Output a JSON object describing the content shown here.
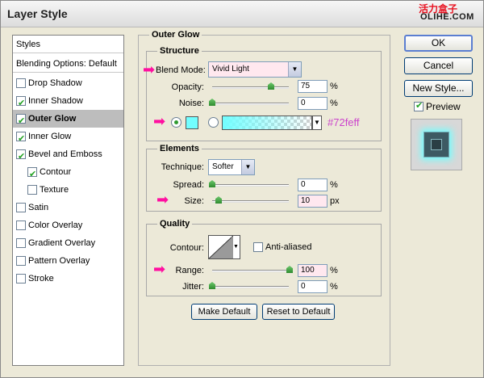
{
  "window": {
    "title": "Layer Style"
  },
  "watermark": {
    "chinese": "活力盒子",
    "site": "OLIHE.COM"
  },
  "styles_list": {
    "header": "Styles",
    "blending": "Blending Options: Default",
    "items": [
      {
        "label": "Drop Shadow",
        "checked": false
      },
      {
        "label": "Inner Shadow",
        "checked": true
      },
      {
        "label": "Outer Glow",
        "checked": true,
        "selected": true
      },
      {
        "label": "Inner Glow",
        "checked": true
      },
      {
        "label": "Bevel and Emboss",
        "checked": true
      },
      {
        "label": "Contour",
        "checked": true,
        "sub": true
      },
      {
        "label": "Texture",
        "checked": false,
        "sub": true
      },
      {
        "label": "Satin",
        "checked": false
      },
      {
        "label": "Color Overlay",
        "checked": false
      },
      {
        "label": "Gradient Overlay",
        "checked": false
      },
      {
        "label": "Pattern Overlay",
        "checked": false
      },
      {
        "label": "Stroke",
        "checked": false
      }
    ]
  },
  "outer_glow": {
    "title": "Outer Glow",
    "structure": {
      "title": "Structure",
      "blend_mode_label": "Blend Mode:",
      "blend_mode_value": "Vivid Light",
      "opacity_label": "Opacity:",
      "opacity_value": "75",
      "opacity_unit": "%",
      "noise_label": "Noise:",
      "noise_value": "0",
      "noise_unit": "%",
      "glow_color": "#72feff",
      "color_annotation": "#72feff"
    },
    "elements": {
      "title": "Elements",
      "technique_label": "Technique:",
      "technique_value": "Softer",
      "spread_label": "Spread:",
      "spread_value": "0",
      "spread_unit": "%",
      "size_label": "Size:",
      "size_value": "10",
      "size_unit": "px"
    },
    "quality": {
      "title": "Quality",
      "contour_label": "Contour:",
      "anti_aliased_label": "Anti-aliased",
      "anti_aliased_checked": false,
      "range_label": "Range:",
      "range_value": "100",
      "range_unit": "%",
      "jitter_label": "Jitter:",
      "jitter_value": "0",
      "jitter_unit": "%"
    },
    "make_default": "Make Default",
    "reset_default": "Reset to Default"
  },
  "buttons": {
    "ok": "OK",
    "cancel": "Cancel",
    "new_style": "New Style...",
    "preview": "Preview",
    "preview_checked": true
  },
  "colors": {
    "accent_arrow": "#ff0fa0",
    "glow": "#72feff",
    "annotation": "#cc44cc"
  }
}
